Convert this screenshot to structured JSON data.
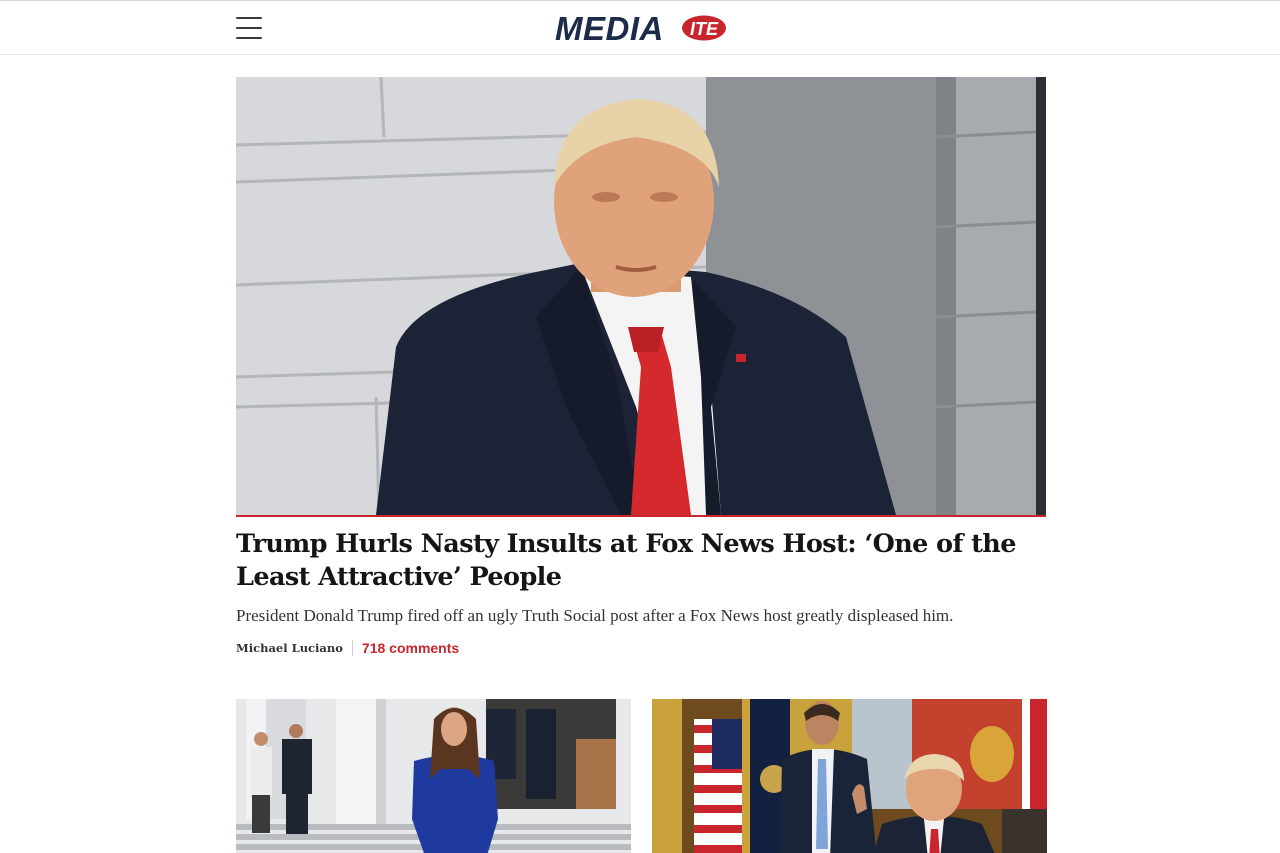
{
  "header": {
    "menu_icon": "hamburger-menu-icon",
    "logo": {
      "main": "MEDIA",
      "badge": "ITE",
      "badge_color": "#c8262c",
      "main_color": "#1d2b4a"
    }
  },
  "hero": {
    "title": "Trump Hurls Nasty Insults at Fox News Host: ‘One of the Least Attractive’ People",
    "dek": "President Donald Trump fired off an ugly Truth Social post after a Fox News host greatly displeased him.",
    "author": "Michael Luciano",
    "comments": "718 comments",
    "accent_color": "#c8262c"
  }
}
